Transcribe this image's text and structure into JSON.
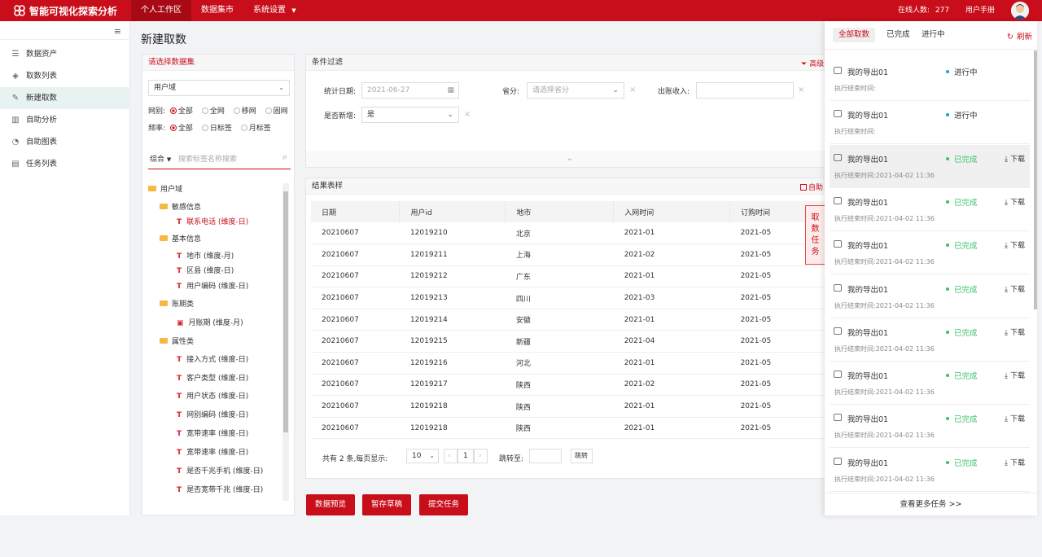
{
  "header": {
    "app_title": "智能可视化探索分析",
    "nav": [
      "个人工作区",
      "数据集市",
      "系统设置"
    ],
    "online_label": "在线人数:",
    "online_count": "277",
    "manual": "用户手册",
    "brand_color": "#c80e1a"
  },
  "sidebar": {
    "collapse_icon": "menu-collapse-icon",
    "items": [
      {
        "label": "数据资产",
        "icon": "database-icon"
      },
      {
        "label": "取数列表",
        "icon": "layers-icon"
      },
      {
        "label": "新建取数",
        "icon": "edit-list-icon",
        "active": true
      },
      {
        "label": "自助分析",
        "icon": "bar-chart-icon"
      },
      {
        "label": "自助图表",
        "icon": "pie-chart-icon"
      },
      {
        "label": "任务列表",
        "icon": "task-icon"
      }
    ]
  },
  "page": {
    "title": "新建取数"
  },
  "dataset_panel": {
    "header": "请选择数据集",
    "select_value": "用户域",
    "net_label": "网别:",
    "net_options": [
      "全部",
      "全网",
      "移网",
      "固网"
    ],
    "freq_label": "频率:",
    "freq_options": [
      "全部",
      "日标签",
      "月标签"
    ],
    "search_scope": "综合",
    "search_placeholder": "搜索标签名称搜索",
    "tree": {
      "root": "用户域",
      "groups": [
        {
          "name": "敏感信息",
          "items": [
            "联系电话 (维度-日)"
          ]
        },
        {
          "name": "基本信息",
          "items": [
            "地市 (维度-月)",
            "区县 (维度-日)",
            "用户编码 (维度-日)"
          ]
        },
        {
          "name": "账期类",
          "items": [
            "月账期 (维度-月)"
          ]
        },
        {
          "name": "属性类",
          "items": [
            "接入方式 (维度-日)",
            "客户类型 (维度-日)",
            "用户状态 (维度-日)",
            "网别编码 (维度-日)",
            "宽带速率 (维度-日)",
            "宽带速率 (维度-日)",
            "是否千兆手机 (维度-日)",
            "是否宽带千兆 (维度-日)"
          ]
        }
      ]
    }
  },
  "filter_panel": {
    "header": "条件过滤",
    "advanced": "高级",
    "date_label": "统计日期:",
    "date_placeholder": "2021-06-27",
    "province_label": "省分:",
    "province_placeholder": "请选择省分",
    "income_label": "出账收入:",
    "new_label": "是否新增:",
    "new_value": "是"
  },
  "result_panel": {
    "header": "结果表样",
    "auto_label": "自助",
    "columns": [
      "日期",
      "用户id",
      "地市",
      "入网时间",
      "订购时间"
    ],
    "rows": [
      [
        "20210607",
        "12019210",
        "北京",
        "2021-01",
        "2021-05"
      ],
      [
        "20210607",
        "12019211",
        "上海",
        "2021-02",
        "2021-05"
      ],
      [
        "20210607",
        "12019212",
        "广东",
        "2021-01",
        "2021-05"
      ],
      [
        "20210607",
        "12019213",
        "四川",
        "2021-03",
        "2021-05"
      ],
      [
        "20210607",
        "12019214",
        "安徽",
        "2021-01",
        "2021-05"
      ],
      [
        "20210607",
        "12019215",
        "新疆",
        "2021-04",
        "2021-05"
      ],
      [
        "20210607",
        "12019216",
        "河北",
        "2021-01",
        "2021-05"
      ],
      [
        "20210607",
        "12019217",
        "陕西",
        "2021-02",
        "2021-05"
      ],
      [
        "20210607",
        "12019218",
        "陕西",
        "2021-01",
        "2021-05"
      ],
      [
        "20210607",
        "12019218",
        "陕西",
        "2021-01",
        "2021-05"
      ]
    ],
    "pagination": {
      "total_text": "共有 2 条,每页显示:",
      "page_size": "10",
      "current_page": "1",
      "jump_label": "跳转至:",
      "jump_button": "跳转"
    }
  },
  "actions": [
    "数据预览",
    "暂存草稿",
    "提交任务"
  ],
  "side_tab": "取数任务",
  "task_panel": {
    "tabs": [
      "全部取数",
      "已完成",
      "进行中"
    ],
    "refresh": "刷新",
    "status_colors": {
      "进行中": "#1aa3c9",
      "已完成": "#3bbf6a"
    },
    "tasks": [
      {
        "name": "我的导出01",
        "status": "进行中",
        "time_label": "执行结束时间:",
        "time": "",
        "download": ""
      },
      {
        "name": "我的导出01",
        "status": "进行中",
        "time_label": "执行结束时间:",
        "time": "",
        "download": ""
      },
      {
        "name": "我的导出01",
        "status": "已完成",
        "time_label": "执行结束时间:",
        "time": "2021-04-02 11:36",
        "download": "下载"
      },
      {
        "name": "我的导出01",
        "status": "已完成",
        "time_label": "执行结束时间:",
        "time": "2021-04-02 11:36",
        "download": "下载"
      },
      {
        "name": "我的导出01",
        "status": "已完成",
        "time_label": "执行结束时间:",
        "time": "2021-04-02 11:36",
        "download": "下载"
      },
      {
        "name": "我的导出01",
        "status": "已完成",
        "time_label": "执行结束时间:",
        "time": "2021-04-02 11:36",
        "download": "下载"
      },
      {
        "name": "我的导出01",
        "status": "已完成",
        "time_label": "执行结束时间:",
        "time": "2021-04-02 11:36",
        "download": "下载"
      },
      {
        "name": "我的导出01",
        "status": "已完成",
        "time_label": "执行结束时间:",
        "time": "2021-04-02 11:36",
        "download": "下载"
      },
      {
        "name": "我的导出01",
        "status": "已完成",
        "time_label": "执行结束时间:",
        "time": "2021-04-02 11:36",
        "download": "下载"
      },
      {
        "name": "我的导出01",
        "status": "已完成",
        "time_label": "执行结束时间:",
        "time": "2021-04-02 11:36",
        "download": "下载"
      }
    ],
    "more": "查看更多任务 >>"
  }
}
